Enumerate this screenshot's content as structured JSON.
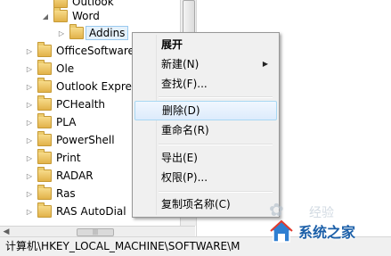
{
  "tree": {
    "items": [
      {
        "label": "Outlook",
        "expander": "",
        "selected": false
      },
      {
        "label": "Word",
        "expander": "◢",
        "selected": false
      },
      {
        "label": "Addins",
        "expander": "▷",
        "selected": true
      },
      {
        "label": "OfficeSoftwareProtectionPlatform",
        "expander": "▷",
        "selected": false
      },
      {
        "label": "Ole",
        "expander": "▷",
        "selected": false
      },
      {
        "label": "Outlook Express",
        "expander": "▷",
        "selected": false
      },
      {
        "label": "PCHealth",
        "expander": "▷",
        "selected": false
      },
      {
        "label": "PLA",
        "expander": "▷",
        "selected": false
      },
      {
        "label": "PowerShell",
        "expander": "▷",
        "selected": false
      },
      {
        "label": "Print",
        "expander": "▷",
        "selected": false
      },
      {
        "label": "RADAR",
        "expander": "▷",
        "selected": false
      },
      {
        "label": "Ras",
        "expander": "▷",
        "selected": false
      },
      {
        "label": "RAS AutoDial",
        "expander": "▷",
        "selected": false
      }
    ]
  },
  "context_menu": {
    "expand": "展开",
    "new": "新建(N)",
    "find": "查找(F)...",
    "delete": "删除(D)",
    "rename": "重命名(R)",
    "export": "导出(E)",
    "permissions": "权限(P)...",
    "copy_key_name": "复制项名称(C)",
    "hovered": "delete"
  },
  "hscroll": {
    "left_arrow": "◀",
    "grip": "|||"
  },
  "status_bar": {
    "path": "计算机\\HKEY_LOCAL_MACHINE\\SOFTWARE\\M"
  },
  "watermark": {
    "text": "系统之家",
    "faint_text": "经验"
  },
  "colors": {
    "selection_border": "#99c9ef",
    "menu_bg": "#f0f0f0",
    "brand_blue": "#1b5fa8"
  }
}
